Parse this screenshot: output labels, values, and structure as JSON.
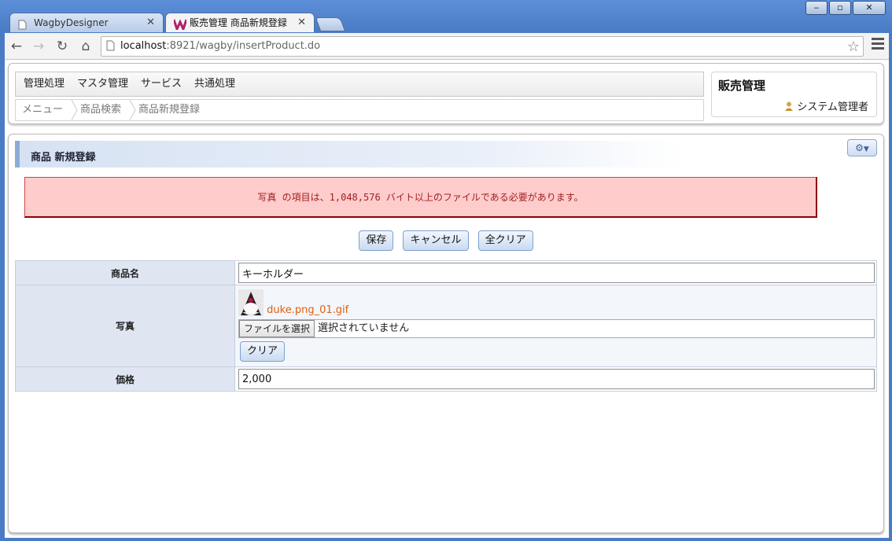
{
  "browser": {
    "tabs": [
      {
        "label": "WagbyDesigner",
        "active": false
      },
      {
        "label": "販売管理 商品新規登録",
        "active": true
      }
    ],
    "url_host": "localhost",
    "url_rest": ":8921/wagby/insertProduct.do"
  },
  "nav": {
    "menu_items": [
      "管理処理",
      "マスタ管理",
      "サービス",
      "共通処理"
    ],
    "breadcrumbs": [
      "メニュー",
      "商品検索",
      "商品新規登録"
    ]
  },
  "app": {
    "title": "販売管理",
    "user": "システム管理者"
  },
  "page": {
    "title": "商品 新規登録",
    "error": "写真 の項目は、1,048,576 バイト以上のファイルである必要があります。",
    "buttons": {
      "save": "保存",
      "cancel": "キャンセル",
      "clear_all": "全クリア"
    }
  },
  "form": {
    "name_label": "商品名",
    "name_value": "キーホルダー",
    "photo_label": "写真",
    "photo_file": "duke.png_01.gif",
    "choose_file": "ファイルを選択",
    "no_file": "選択されていません",
    "clear": "クリア",
    "price_label": "価格",
    "price_value": "2,000"
  },
  "colors": {
    "error_bg": "#ffcccc",
    "error_text": "#a02020",
    "link": "#e06010",
    "label_bg": "#dfe6f2"
  }
}
